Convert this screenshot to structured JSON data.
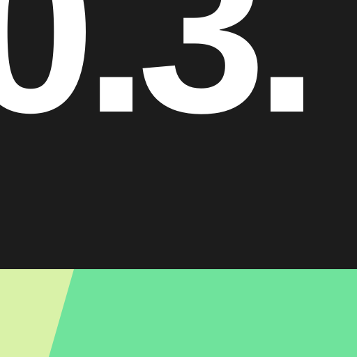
{
  "version": {
    "text": "0.3."
  },
  "colors": {
    "background": "#1c1c1c",
    "text": "#ffffff",
    "band_green": "#6fe39c",
    "band_lime": "#d9f2a8"
  }
}
